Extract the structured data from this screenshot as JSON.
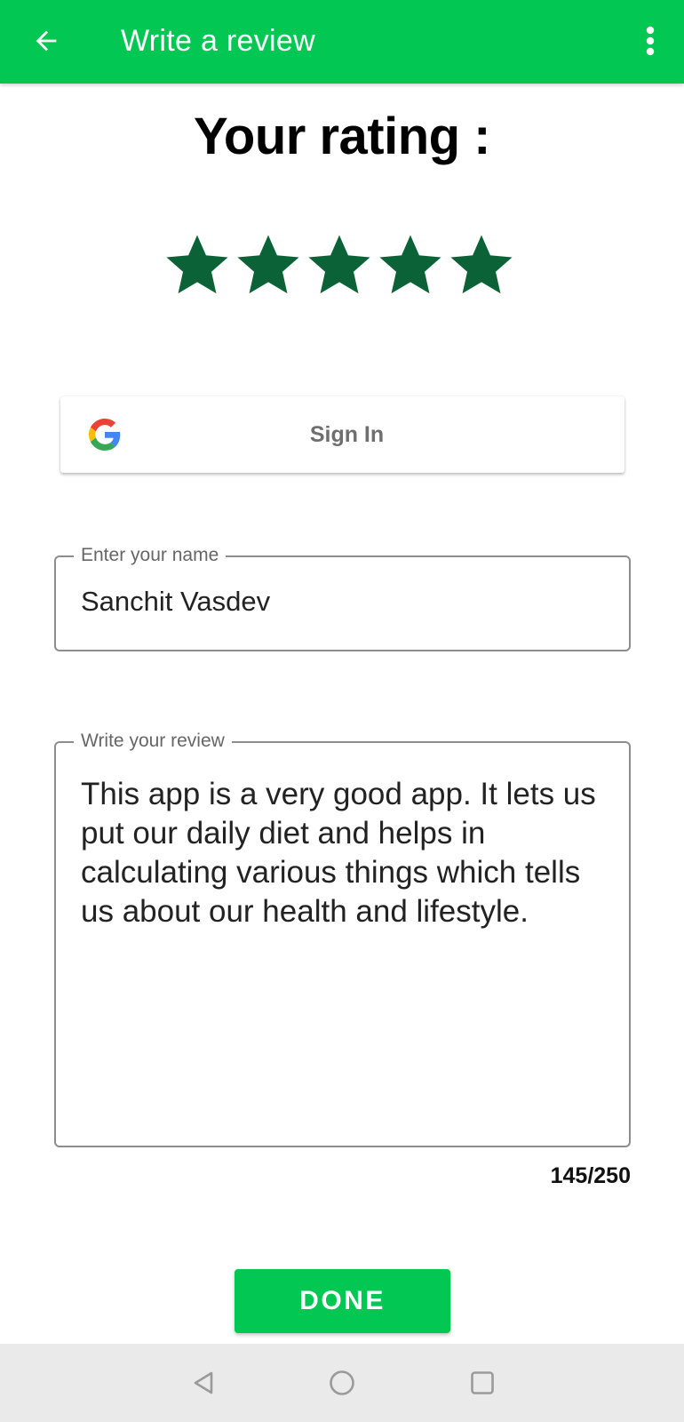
{
  "app_bar": {
    "title": "Write a review",
    "back_icon": "arrow-left-icon",
    "more_icon": "more-vert-icon",
    "color": "#02c853"
  },
  "rating": {
    "heading": "Your rating :",
    "value": 5,
    "max": 5,
    "star_color": "#0b6236"
  },
  "signin": {
    "label": "Sign In",
    "icon": "google-icon"
  },
  "name_field": {
    "label": "Enter your name",
    "value": "Sanchit Vasdev"
  },
  "review_field": {
    "label": "Write your review",
    "value": "This app is a very good app. It lets us put our daily diet and helps in calculating various things which tells us about our health and lifestyle.",
    "counter": "145/250"
  },
  "done_button": {
    "label": "DONE"
  },
  "system_nav": {
    "back_icon": "nav-back-icon",
    "home_icon": "nav-home-icon",
    "recents_icon": "nav-recents-icon"
  }
}
